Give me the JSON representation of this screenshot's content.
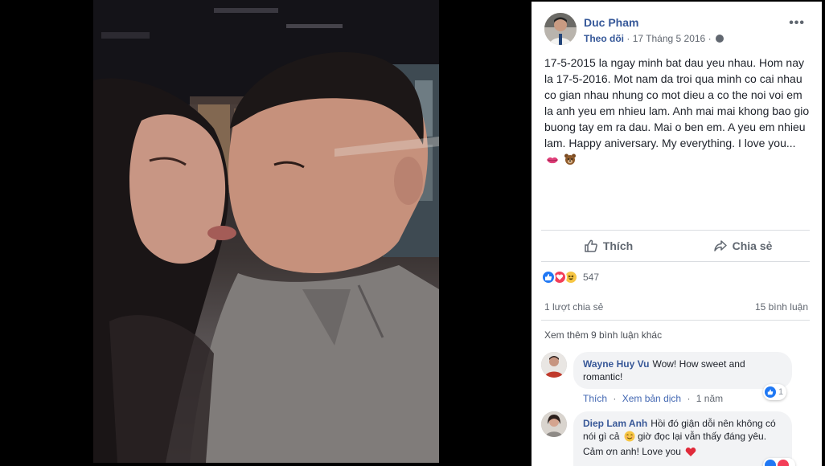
{
  "post": {
    "author": "Duc Pham",
    "follow_label": "Theo dõi",
    "separator": "·",
    "date": "17 Tháng 5 2016",
    "more_label": "•••",
    "text": "17-5-2015 la ngay minh bat dau yeu nhau. Hom nay la 17-5-2016. Mot nam da troi qua minh co cai nhau co gian nhau nhung co mot dieu a co the noi voi em la anh yeu em nhieu lam. Anh mai mai khong bao gio buong tay em ra dau. Mai o ben em. A yeu em nhieu lam. Happy aniversary. My everything. I love you...",
    "emojis": [
      "kiss-lips-emoji",
      "bear-emoji"
    ]
  },
  "actions": {
    "like_label": "Thích",
    "share_label": "Chia sẻ"
  },
  "reactions": {
    "types": [
      "like",
      "love",
      "haha"
    ],
    "count": "547"
  },
  "stats": {
    "shares": "1 lượt chia sẻ",
    "comments": "15 bình luận"
  },
  "view_more_label": "Xem thêm 9 bình luận khác",
  "comments": [
    {
      "author": "Wayne Huy Vu",
      "text": "Wow! How sweet and romantic!",
      "like_label": "Thích",
      "translate_label": "Xem bản dịch",
      "separator": "·",
      "time": "1 năm",
      "reaction_count": "1"
    },
    {
      "author": "Diep Lam Anh",
      "text_part1": "Hồi đó giận dỗi nên không có nói gì cả",
      "text_part2": "giờ đọc lại vẫn thấy đáng yêu. Cảm ơn anh! Love you",
      "emojis": [
        "smiling-face-emoji",
        "red-heart-emoji"
      ]
    }
  ],
  "colors": {
    "link_blue": "#365899",
    "like_blue": "#2078f4",
    "love_red": "#f33e58",
    "haha_yellow": "#f7c644",
    "panel_bg": "#ffffff",
    "stage_bg": "#000000"
  }
}
